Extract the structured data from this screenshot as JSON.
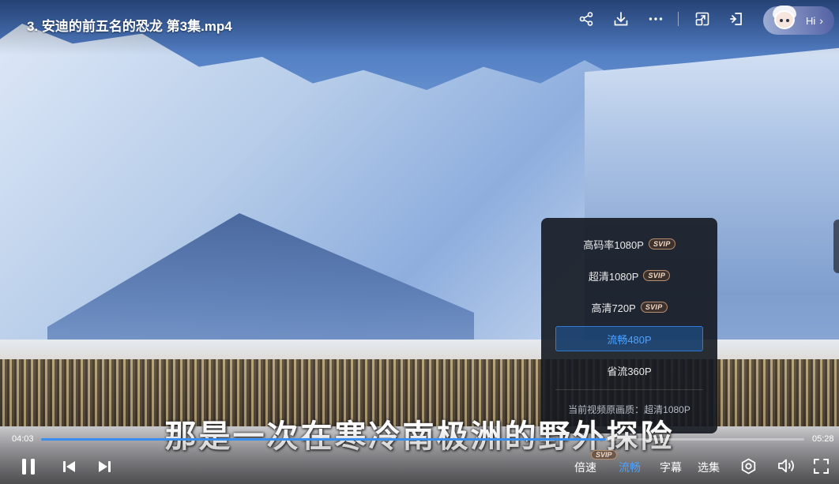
{
  "video": {
    "title": "3. 安迪的前五名的恐龙 第3集.mp4",
    "subtitle": "那是一次在寒冷南极洲的野外探险",
    "current_time": "04:03",
    "total_time": "05:28",
    "progress": 0.74
  },
  "top_bar": {
    "icons": [
      "share-icon",
      "download-icon",
      "more-icon",
      "picture-in-picture-icon",
      "exit-icon"
    ],
    "assistant_label": "Hi"
  },
  "quality_menu": {
    "options": [
      {
        "label": "高码率1080P",
        "badge": "SVIP",
        "active": false
      },
      {
        "label": "超清1080P",
        "badge": "SVIP",
        "active": false
      },
      {
        "label": "高清720P",
        "badge": "SVIP",
        "active": false
      },
      {
        "label": "流畅480P",
        "badge": "",
        "active": true
      },
      {
        "label": "省流360P",
        "badge": "",
        "active": false
      }
    ],
    "footer": "当前视频原画质：超清1080P"
  },
  "controls": {
    "speed_label": "倍速",
    "speed_badge": "SVIP",
    "quality_label": "流畅",
    "subtitle_label": "字幕",
    "episodes_label": "选集"
  },
  "colors": {
    "accent": "#4da3ff",
    "progress": "#3a8ef0",
    "menu_bg": "#14181f"
  }
}
